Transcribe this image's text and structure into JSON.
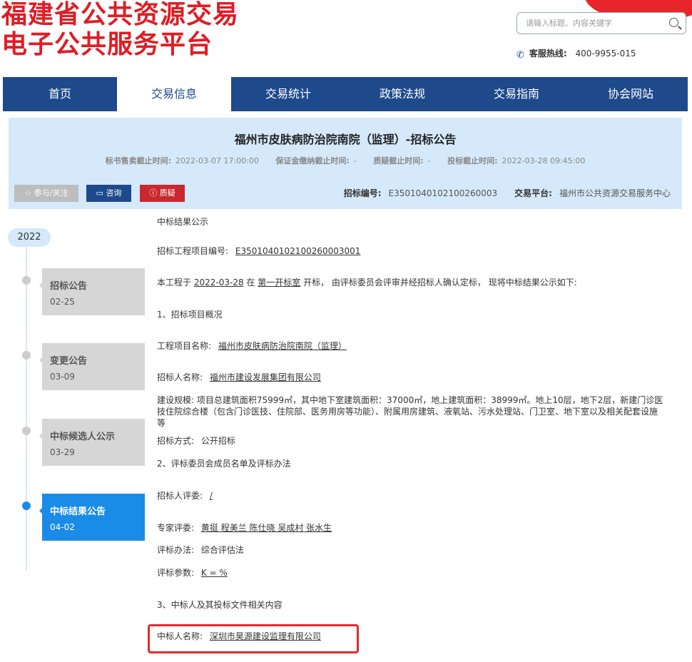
{
  "header": {
    "logo_line1": "福建省公共资源交易",
    "logo_line2": "电子公共服务平台",
    "search_placeholder": "请输入标题、内容关键字",
    "hotline_label": "客服热线:",
    "hotline_number": "400-9955-015"
  },
  "nav": {
    "items": [
      "首页",
      "交易信息",
      "交易统计",
      "政策法规",
      "交易指南",
      "协会网站"
    ],
    "active_index": 1
  },
  "notice": {
    "title": "福州市皮肤病防治院南院（监理）-招标公告",
    "times": [
      {
        "label": "标书售卖截止时间:",
        "value": "2022-03-07 17:00:00"
      },
      {
        "label": "保证金缴纳截止时间:",
        "value": "-"
      },
      {
        "label": "质疑截止时间:",
        "value": "-"
      },
      {
        "label": "投标截止时间:",
        "value": "2022-03-28 09:45:00"
      }
    ],
    "buttons": {
      "follow": "☆ 参与/关注",
      "consult": "咨询",
      "query": "质疑"
    },
    "code_label": "招标编号:",
    "code_value": "E3501040102100260003",
    "platform_label": "交易平台:",
    "platform_value": "福州市公共资源交易服务中心"
  },
  "timeline": {
    "year": "2022",
    "items": [
      {
        "name": "招标公告",
        "date": "02-25"
      },
      {
        "name": "变更公告",
        "date": "03-09"
      },
      {
        "name": "中标候选人公示",
        "date": "03-29"
      },
      {
        "name": "中标结果公告",
        "date": "04-02"
      }
    ]
  },
  "content": {
    "heading": "中标结果公示",
    "project_no_label": "招标工程项目编号:",
    "project_no": "E3501040102100260003001",
    "intro_a": "本工程于",
    "intro_date": "2022-03-28",
    "intro_b": "在",
    "intro_room": "第一开标室",
    "intro_c": "开标，  由评标委员会评审并经招标人确认定标，  现将中标结果公示如下:",
    "sec1": "1、招标项目概况",
    "project_name_label": "工程项目名称:",
    "project_name": "福州市皮肤病防治院南院（监理）",
    "tenderer_label": "招标人名称:",
    "tenderer": "福州市建设发展集团有限公司",
    "scale": "建设规模:  项目总建筑面积75999㎡，其中地下室建筑面积：37000㎡，地上建筑面积：38999㎡。地上10层，地下2层，新建门诊医技住院综合楼（包含门诊医技、住院部、医务用房等功能）、附属用房建筑、液氧站、污水处理站、门卫室、地下室以及相关配套设施等",
    "method_label": "招标方式:",
    "method": "公开招标",
    "sec2": "2、评标委员会成员名单及评标办法",
    "owner_judge_label": "招标人评委:",
    "owner_judge": "/",
    "experts_label": "专家评委:",
    "experts": "黄挺 程美兰 陈仕晓 吴成村 张水生",
    "eval_method_label": "评标办法:",
    "eval_method": "综合评估法",
    "eval_param_label": "评标参数:",
    "eval_param": "K = %",
    "sec3": "3、中标人及其投标文件相关内容",
    "winner_label": "中标人名称:",
    "winner": "深圳市昊源建设监理有限公司"
  },
  "colors": {
    "brand_blue": "#1e4a8b",
    "logo_red": "#e01c23",
    "active_blue": "#1a8be6",
    "highlight": "#e42b2b"
  }
}
